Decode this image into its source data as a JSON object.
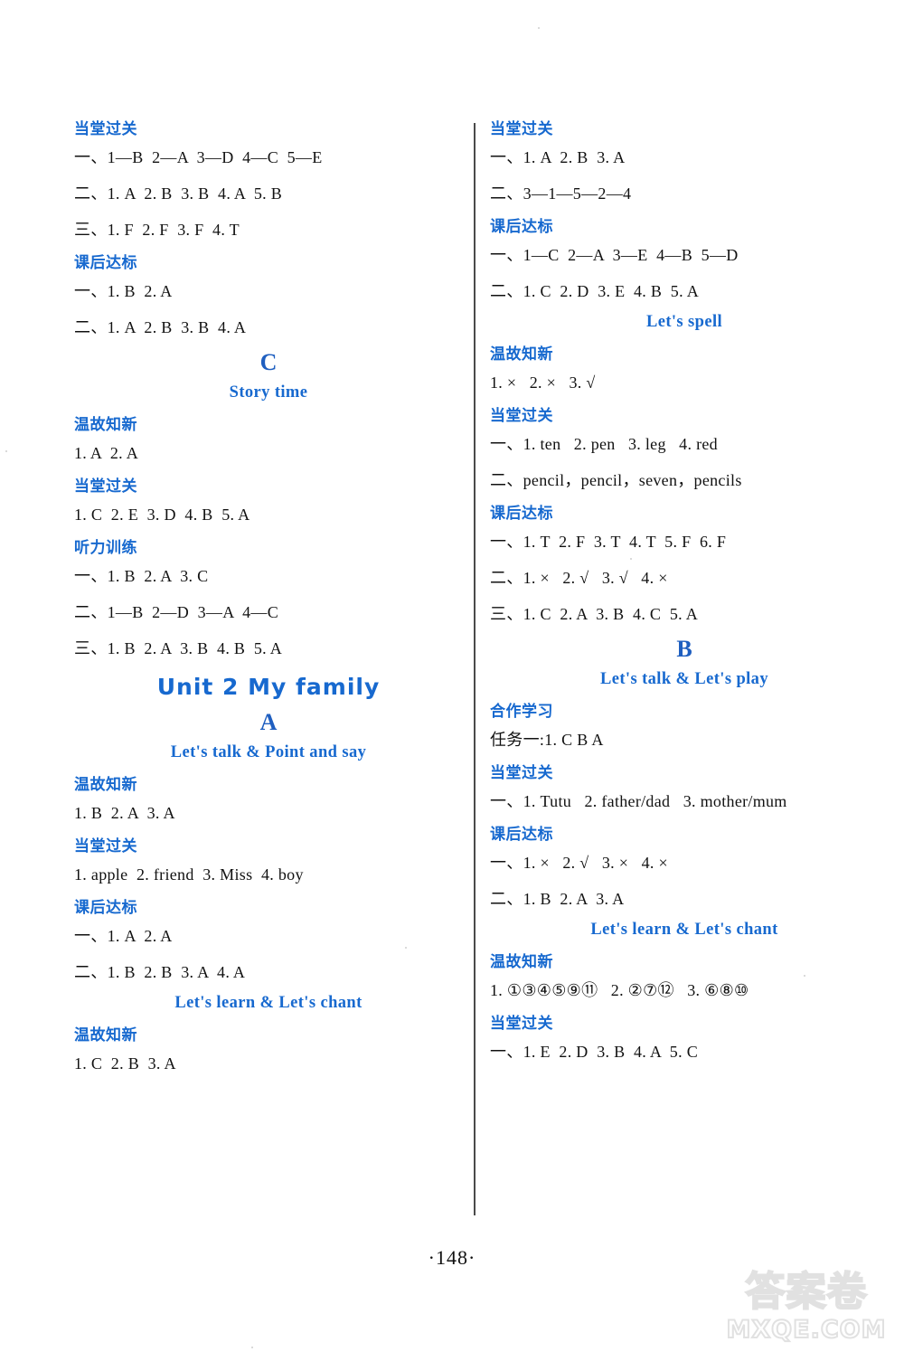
{
  "page": {
    "number": "·148·",
    "watermark_cn": "答案卷",
    "watermark_en": "MXQE.COM"
  },
  "left_column": {
    "blocks": [
      {
        "kind": "answers",
        "heading": "当堂过关",
        "lines": [
          "一、1—B  2—A  3—D  4—C  5—E",
          "二、1. A  2. B  3. B  4. A  5. B",
          "三、1. F  2. F  3. F  4. T"
        ]
      },
      {
        "kind": "answers",
        "heading": "课后达标",
        "lines": [
          "一、1. B  2. A",
          "二、1. A  2. B  3. B  4. A"
        ]
      },
      {
        "kind": "section_letter",
        "text": "C"
      },
      {
        "kind": "sub_title",
        "text": "Story time"
      },
      {
        "kind": "answers",
        "heading": "温故知新",
        "lines": [
          "1. A  2. A"
        ]
      },
      {
        "kind": "answers",
        "heading": "当堂过关",
        "lines": [
          "1. C  2. E  3. D  4. B  5. A"
        ]
      },
      {
        "kind": "answers",
        "heading": "听力训练",
        "lines": [
          "一、1. B  2. A  3. C",
          "二、1—B  2—D  3—A  4—C",
          "三、1. B  2. A  3. B  4. B  5. A"
        ]
      },
      {
        "kind": "unit_title",
        "text": "Unit 2   My family"
      },
      {
        "kind": "section_letter",
        "text": "A"
      },
      {
        "kind": "sub_title",
        "text": "Let's talk & Point and say"
      },
      {
        "kind": "answers",
        "heading": "温故知新",
        "lines": [
          "1. B  2. A  3. A"
        ]
      },
      {
        "kind": "answers",
        "heading": "当堂过关",
        "lines": [
          "1. apple  2. friend  3. Miss  4. boy"
        ]
      },
      {
        "kind": "answers",
        "heading": "课后达标",
        "lines": [
          "一、1. A  2. A",
          "二、1. B  2. B  3. A  4. A"
        ]
      },
      {
        "kind": "sub_title",
        "text": "Let's learn & Let's chant"
      },
      {
        "kind": "answers",
        "heading": "温故知新",
        "lines": [
          "1. C  2. B  3. A"
        ]
      }
    ]
  },
  "right_column": {
    "blocks": [
      {
        "kind": "answers",
        "heading": "当堂过关",
        "lines": [
          "一、1. A  2. B  3. A",
          "二、3—1—5—2—4"
        ]
      },
      {
        "kind": "answers",
        "heading": "课后达标",
        "lines": [
          "一、1—C  2—A  3—E  4—B  5—D",
          "二、1. C  2. D  3. E  4. B  5. A"
        ]
      },
      {
        "kind": "sub_title",
        "text": "Let's spell"
      },
      {
        "kind": "answers",
        "heading": "温故知新",
        "lines": [
          "1. ×   2. ×   3. √"
        ]
      },
      {
        "kind": "answers",
        "heading": "当堂过关",
        "lines": [
          "一、1. ten   2. pen   3. leg   4. red",
          "二、pencil，pencil，seven，pencils"
        ]
      },
      {
        "kind": "answers",
        "heading": "课后达标",
        "lines": [
          "一、1. T  2. F  3. T  4. T  5. F  6. F",
          "二、1. ×   2. √   3. √   4. ×",
          "三、1. C  2. A  3. B  4. C  5. A"
        ]
      },
      {
        "kind": "section_letter",
        "text": "B"
      },
      {
        "kind": "sub_title",
        "text": "Let's talk & Let's play"
      },
      {
        "kind": "answers",
        "heading": "合作学习",
        "lines": [
          "任务一:1. C B A"
        ]
      },
      {
        "kind": "answers",
        "heading": "当堂过关",
        "lines": [
          "一、1. Tutu   2. father/dad   3. mother/mum"
        ]
      },
      {
        "kind": "answers",
        "heading": "课后达标",
        "lines": [
          "一、1. ×   2. √   3. ×   4. ×",
          "二、1. B  2. A  3. A"
        ]
      },
      {
        "kind": "sub_title",
        "text": "Let's learn & Let's chant"
      },
      {
        "kind": "answers",
        "heading": "温故知新",
        "lines": [
          "1. ①③④⑤⑨⑪   2. ②⑦⑫   3. ⑥⑧⑩"
        ]
      },
      {
        "kind": "answers",
        "heading": "当堂过关",
        "lines": [
          "一、1. E  2. D  3. B  4. A  5. C"
        ]
      }
    ]
  },
  "colors": {
    "heading_blue": "#1769cf",
    "title_blue": "#1f5fc0",
    "body_black": "#111111",
    "divider_gray": "#4a4a4a"
  }
}
